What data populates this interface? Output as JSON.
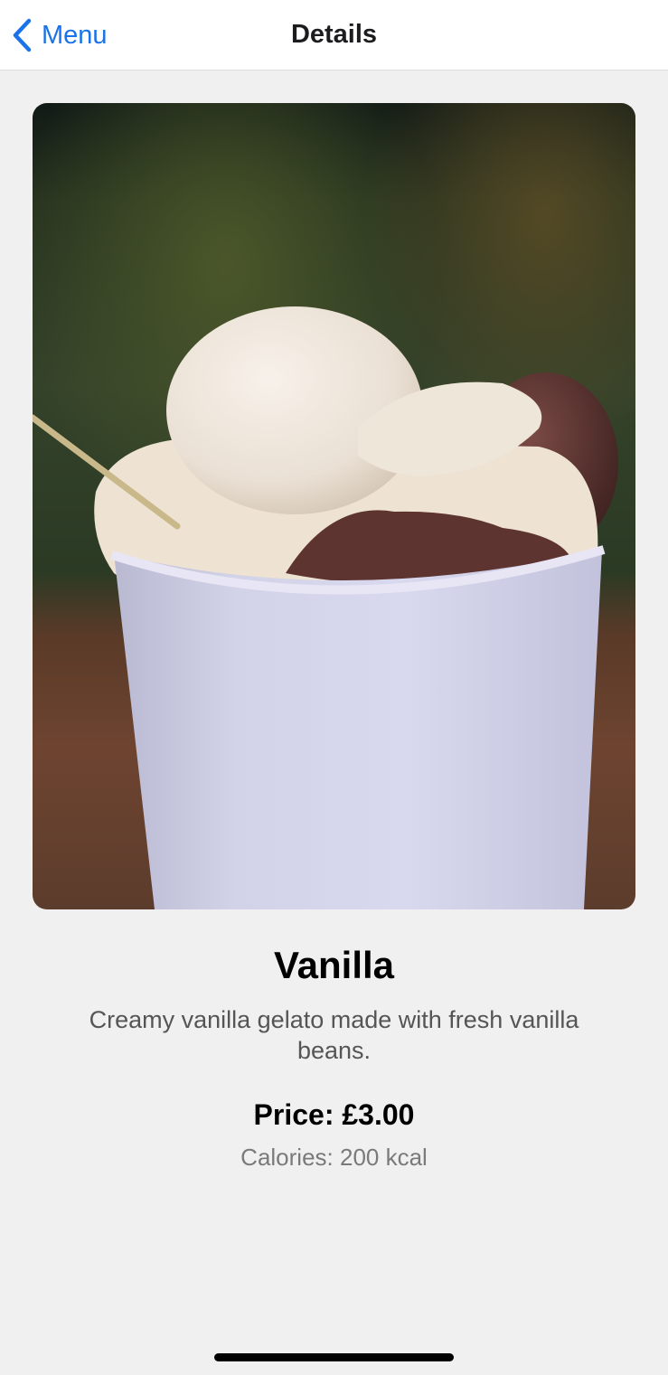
{
  "nav": {
    "back_label": "Menu",
    "title": "Details",
    "accent_color": "#1a73e8"
  },
  "product": {
    "image_icon": "ice-cream-photo",
    "name": "Vanilla",
    "description": "Creamy vanilla gelato made with fresh vanilla beans.",
    "price": "Price: £3.00",
    "calories": "Calories: 200 kcal"
  }
}
